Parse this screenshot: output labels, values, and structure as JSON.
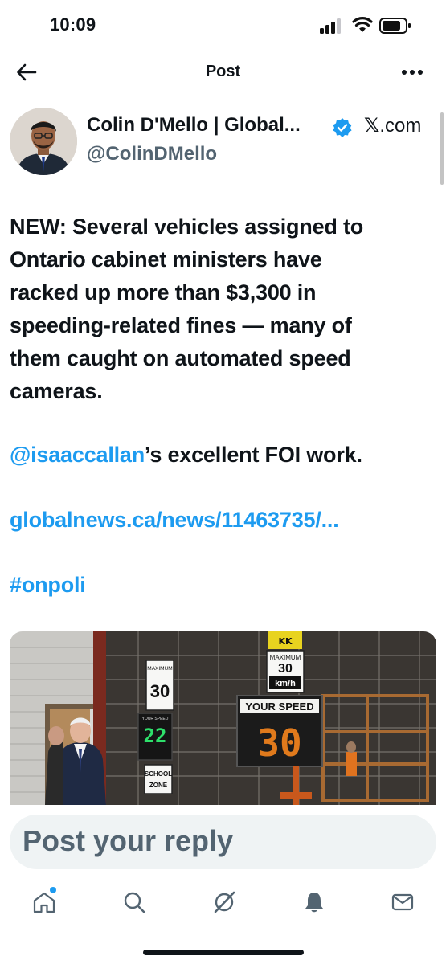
{
  "status_bar": {
    "time": "10:09",
    "icons": [
      "cellular-signal-icon",
      "wifi-icon",
      "battery-icon"
    ]
  },
  "header": {
    "title": "Post",
    "back_icon": "arrow-left-icon",
    "more_icon": "more-horizontal-icon"
  },
  "author": {
    "name": "Colin D'Mello | Global...",
    "handle": "@ColinDMello",
    "verified": true,
    "source_label": "X.com",
    "source_glyph": "𝕏",
    "source_suffix": ".com"
  },
  "post": {
    "lines": [
      "NEW: Several vehicles assigned to",
      "Ontario cabinet ministers have",
      "racked up more than $3,300 in",
      "speeding-related fines — many of",
      "them caught on automated speed",
      "cameras."
    ],
    "mention": "@isaaccallan",
    "mention_suffix": "’s excellent FOI work.",
    "link": "globalnews.ca/news/11463735/...",
    "hashtag": "#onpoli"
  },
  "media": {
    "signs": {
      "maximum_label": "MAXIMUM",
      "maximum_value": "30",
      "unit": "km/h",
      "your_speed_label": "YOUR SPEED",
      "your_speed_value": "30",
      "green_display_value": "22",
      "green_display_label": "YOUR SPEED",
      "school_zone_line1": "SCHOOL",
      "school_zone_line2": "ZONE"
    }
  },
  "reply": {
    "placeholder": "Post your reply"
  },
  "bottom_nav": {
    "items": [
      "home-icon",
      "search-icon",
      "grok-icon",
      "notifications-icon",
      "messages-icon"
    ]
  },
  "colors": {
    "accent": "#1d9bf0",
    "text": "#0f1419",
    "muted": "#536471",
    "reply_bg": "#eff3f4"
  }
}
